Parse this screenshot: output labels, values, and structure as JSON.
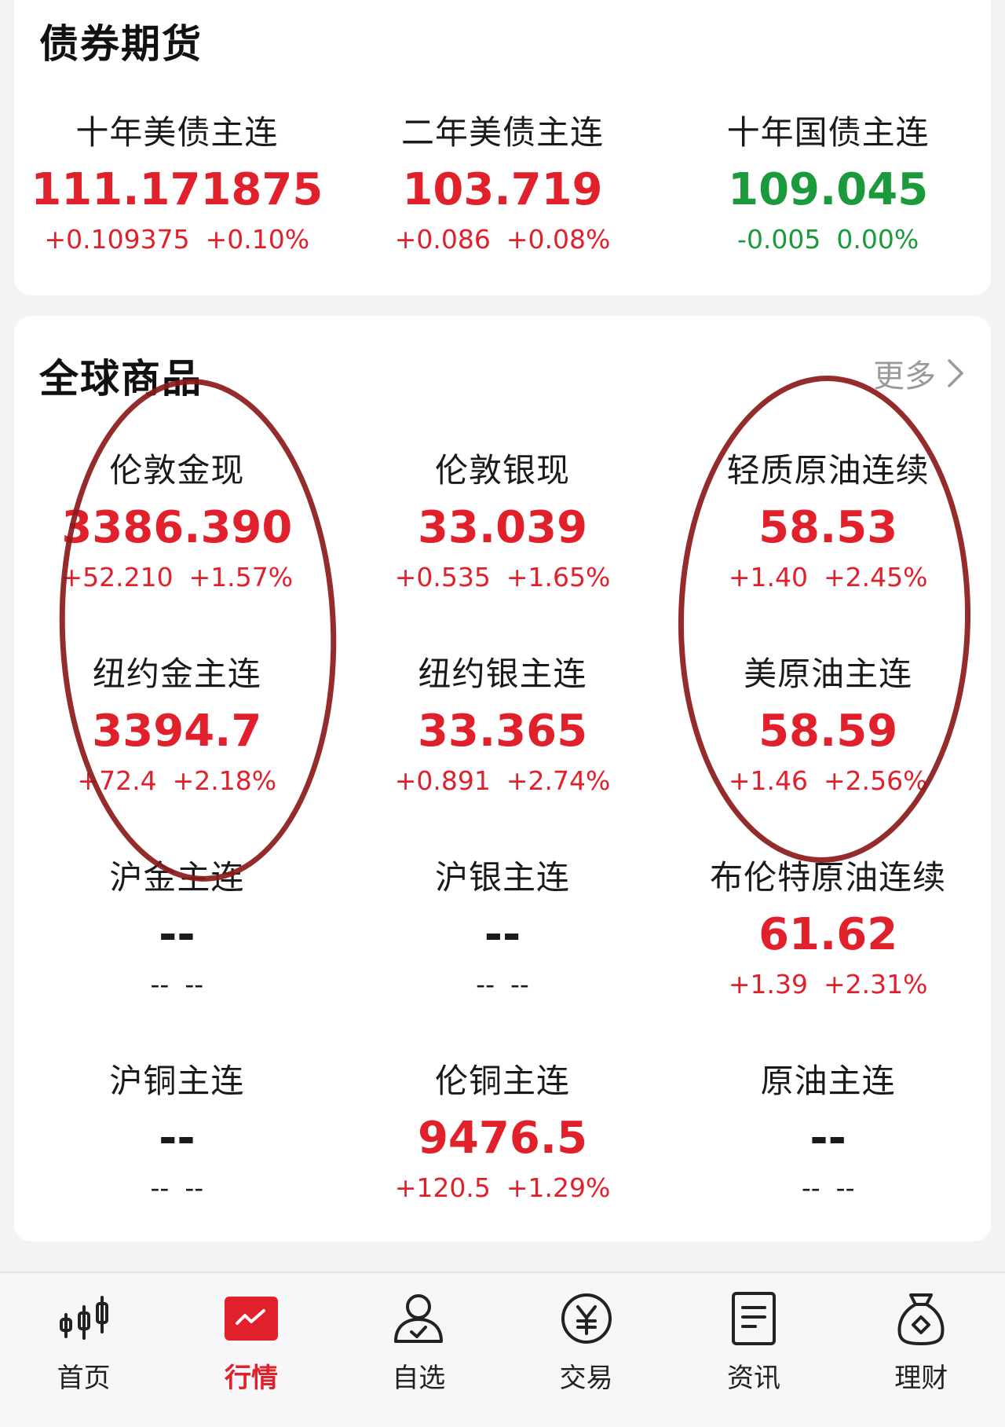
{
  "bond_section": {
    "title": "债券期货",
    "quotes": [
      {
        "name": "十年美债主连",
        "price": "111.171875",
        "change": "+0.109375",
        "pct": "+0.10%",
        "dir": "up"
      },
      {
        "name": "二年美债主连",
        "price": "103.719",
        "change": "+0.086",
        "pct": "+0.08%",
        "dir": "up"
      },
      {
        "name": "十年国债主连",
        "price": "109.045",
        "change": "-0.005",
        "pct": "0.00%",
        "dir": "down"
      }
    ]
  },
  "commodity_section": {
    "title": "全球商品",
    "more_label": "更多",
    "quotes": [
      {
        "name": "伦敦金现",
        "price": "3386.390",
        "change": "+52.210",
        "pct": "+1.57%",
        "dir": "up"
      },
      {
        "name": "伦敦银现",
        "price": "33.039",
        "change": "+0.535",
        "pct": "+1.65%",
        "dir": "up"
      },
      {
        "name": "轻质原油连续",
        "price": "58.53",
        "change": "+1.40",
        "pct": "+2.45%",
        "dir": "up"
      },
      {
        "name": "纽约金主连",
        "price": "3394.7",
        "change": "+72.4",
        "pct": "+2.18%",
        "dir": "up"
      },
      {
        "name": "纽约银主连",
        "price": "33.365",
        "change": "+0.891",
        "pct": "+2.74%",
        "dir": "up"
      },
      {
        "name": "美原油主连",
        "price": "58.59",
        "change": "+1.46",
        "pct": "+2.56%",
        "dir": "up"
      },
      {
        "name": "沪金主连",
        "price": "--",
        "change": "--",
        "pct": "--",
        "dir": "flat"
      },
      {
        "name": "沪银主连",
        "price": "--",
        "change": "--",
        "pct": "--",
        "dir": "flat"
      },
      {
        "name": "布伦特原油连续",
        "price": "61.62",
        "change": "+1.39",
        "pct": "+2.31%",
        "dir": "up"
      },
      {
        "name": "沪铜主连",
        "price": "--",
        "change": "--",
        "pct": "--",
        "dir": "flat"
      },
      {
        "name": "伦铜主连",
        "price": "9476.5",
        "change": "+120.5",
        "pct": "+1.29%",
        "dir": "up"
      },
      {
        "name": "原油主连",
        "price": "--",
        "change": "--",
        "pct": "--",
        "dir": "flat"
      }
    ]
  },
  "colors": {
    "up": "#e0202b",
    "down": "#1a9a3a",
    "annotation": "#8b1a1a"
  },
  "tab_bar": {
    "items": [
      {
        "label": "首页",
        "icon": "candlestick-icon",
        "active": false
      },
      {
        "label": "行情",
        "icon": "market-chart-icon",
        "active": true
      },
      {
        "label": "自选",
        "icon": "user-check-icon",
        "active": false
      },
      {
        "label": "交易",
        "icon": "yuan-coin-icon",
        "active": false
      },
      {
        "label": "资讯",
        "icon": "document-icon",
        "active": false
      },
      {
        "label": "理财",
        "icon": "money-bag-icon",
        "active": false
      }
    ]
  }
}
